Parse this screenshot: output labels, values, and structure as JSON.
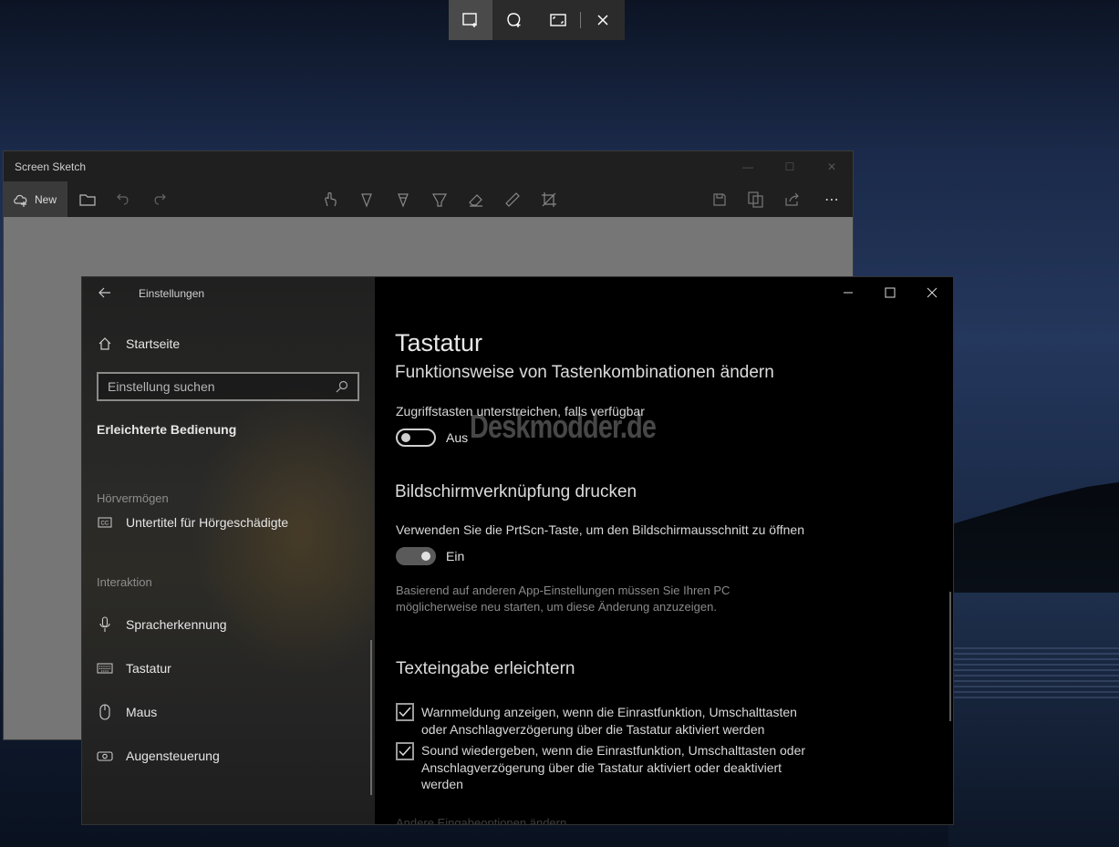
{
  "snip_toolbar": {
    "buttons": [
      "rectangular-snip",
      "freeform-snip",
      "fullscreen-snip",
      "close"
    ]
  },
  "sketch": {
    "title": "Screen Sketch",
    "new_label": "New",
    "more": "⋯"
  },
  "settings": {
    "header_title": "Einstellungen",
    "home": "Startseite",
    "search_placeholder": "Einstellung suchen",
    "section": "Erleichterte Bedienung",
    "groups": [
      {
        "label": "Hörvermögen",
        "items": [
          "Untertitel für Hörgeschädigte"
        ]
      },
      {
        "label": "Interaktion",
        "items": [
          "Spracherkennung",
          "Tastatur",
          "Maus",
          "Augensteuerung"
        ]
      }
    ],
    "content": {
      "title": "Tastatur",
      "subtitle": "Funktionsweise von Tastenkombinationen ändern",
      "access_keys_label": "Zugriffstasten unterstreichen, falls verfügbar",
      "access_keys_state": "Aus",
      "print_heading": "Bildschirmverknüpfung drucken",
      "print_desc": "Verwenden Sie die PrtScn-Taste, um den Bildschirmausschnitt zu öffnen",
      "print_state": "Ein",
      "restart_note_1": "Basierend auf anderen App-Einstellungen müssen Sie Ihren PC",
      "restart_note_2": "möglicherweise neu starten, um diese Änderung anzuzeigen.",
      "typing_heading": "Texteingabe erleichtern",
      "check1": "Warnmeldung anzeigen, wenn die Einrastfunktion, Umschalttasten oder Anschlagverzögerung über die Tastatur aktiviert werden",
      "check2": "Sound wiedergeben, wenn die Einrastfunktion, Umschalttasten oder Anschlagverzögerung über die Tastatur aktiviert oder deaktiviert werden",
      "faded_link": "Andere Eingabeoptionen ändern"
    }
  },
  "watermark": "Deskmodder.de"
}
